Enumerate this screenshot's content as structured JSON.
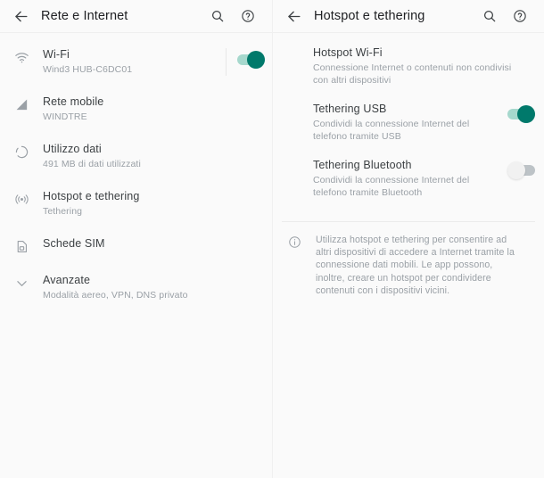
{
  "theme": {
    "background": "#fafafa",
    "title_color": "#202124",
    "primary_text": "#3c4043",
    "secondary_text": "#9aa0a6",
    "accent_on": "#00796b",
    "track_on": "#a6d8cd",
    "track_off": "#bdc3c7",
    "divider": "#ececec"
  },
  "left_panel": {
    "appbar": {
      "back_icon": "arrow-back-icon",
      "title": "Rete e Internet",
      "search_icon": "search-icon",
      "help_icon": "help-circle-icon"
    },
    "items": [
      {
        "icon": "wifi-icon",
        "title": "Wi-Fi",
        "subtitle": "Wind3 HUB-C6DC01",
        "has_toggle": true,
        "toggle_on": true
      },
      {
        "icon": "signal-cellular-icon",
        "title": "Rete mobile",
        "subtitle": "WINDTRE",
        "has_toggle": false
      },
      {
        "icon": "data-usage-icon",
        "title": "Utilizzo dati",
        "subtitle": "491 MB di dati utilizzati",
        "has_toggle": false
      },
      {
        "icon": "hotspot-icon",
        "title": "Hotspot e tethering",
        "subtitle": "Tethering",
        "has_toggle": false
      },
      {
        "icon": "sim-card-icon",
        "title": "Schede SIM",
        "subtitle": "",
        "has_toggle": false
      },
      {
        "icon": "chevron-down-icon",
        "title": "Avanzate",
        "subtitle": "Modalità aereo, VPN, DNS privato",
        "has_toggle": false
      }
    ]
  },
  "right_panel": {
    "appbar": {
      "back_icon": "arrow-back-icon",
      "title": "Hotspot e tethering",
      "search_icon": "search-icon",
      "help_icon": "help-circle-icon"
    },
    "items": [
      {
        "title": "Hotspot Wi-Fi",
        "subtitle": "Connessione Internet o contenuti non condivisi con altri dispositivi",
        "has_toggle": false
      },
      {
        "title": "Tethering USB",
        "subtitle": "Condividi la connessione Internet del telefono tramite USB",
        "has_toggle": true,
        "toggle_on": true
      },
      {
        "title": "Tethering Bluetooth",
        "subtitle": "Condividi la connessione Internet del telefono tramite Bluetooth",
        "has_toggle": true,
        "toggle_on": false
      }
    ],
    "info": {
      "icon": "info-circle-icon",
      "text": "Utilizza hotspot e tethering per consentire ad altri dispositivi di accedere a Internet tramite la connessione dati mobili. Le app possono, inoltre, creare un hotspot per condividere contenuti con i dispositivi vicini."
    }
  }
}
